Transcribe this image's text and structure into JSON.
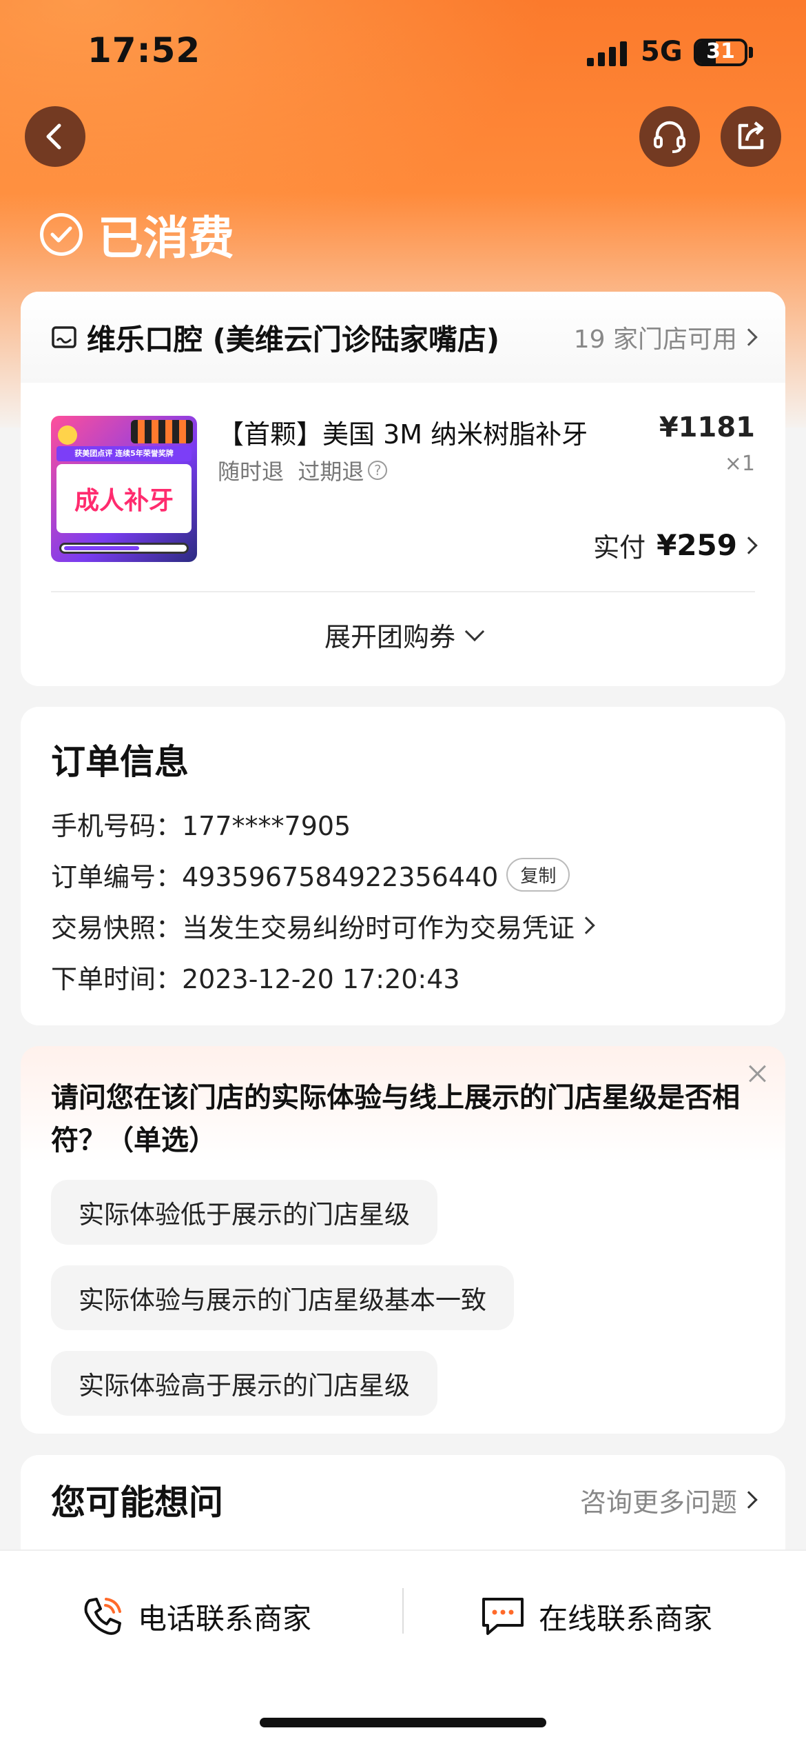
{
  "status_bar": {
    "time": "17:52",
    "network": "5G",
    "battery": "31"
  },
  "header": {
    "status_title": "已消费"
  },
  "store": {
    "name": "维乐口腔 (美维云门诊陆家嘴店)",
    "availability": "19 家门店可用",
    "product": {
      "thumb_text": "成人补牙",
      "thumb_banner": "获美团点评 连续5年荣誉奖牌",
      "title": "【首颗】美国 3M 纳米树脂补牙",
      "tags": "随时退  过期退",
      "price": "¥1181",
      "quantity": "×1",
      "paid_label": "实付",
      "paid_amount": "¥259"
    },
    "expand_label": "展开团购券"
  },
  "order": {
    "title": "订单信息",
    "phone": "手机号码：177****7905",
    "number": "订单编号：4935967584922356440",
    "copy_label": "复制",
    "snapshot": "交易快照：当发生交易纠纷时可作为交易凭证",
    "time": "下单时间：2023-12-20 17:20:43"
  },
  "survey": {
    "question": "请问您在该门店的实际体验与线上展示的门店星级是否相符？（单选）",
    "options": [
      "实际体验低于展示的门店星级",
      "实际体验与展示的门店星级基本一致",
      "实际体验高于展示的门店星级"
    ]
  },
  "faq": {
    "title": "您可能想问",
    "more": "咨询更多问题"
  },
  "bottom_bar": {
    "phone_contact": "电话联系商家",
    "online_contact": "在线联系商家"
  },
  "colors": {
    "orange": "#fb7a2c",
    "button_brown": "#733a22"
  }
}
